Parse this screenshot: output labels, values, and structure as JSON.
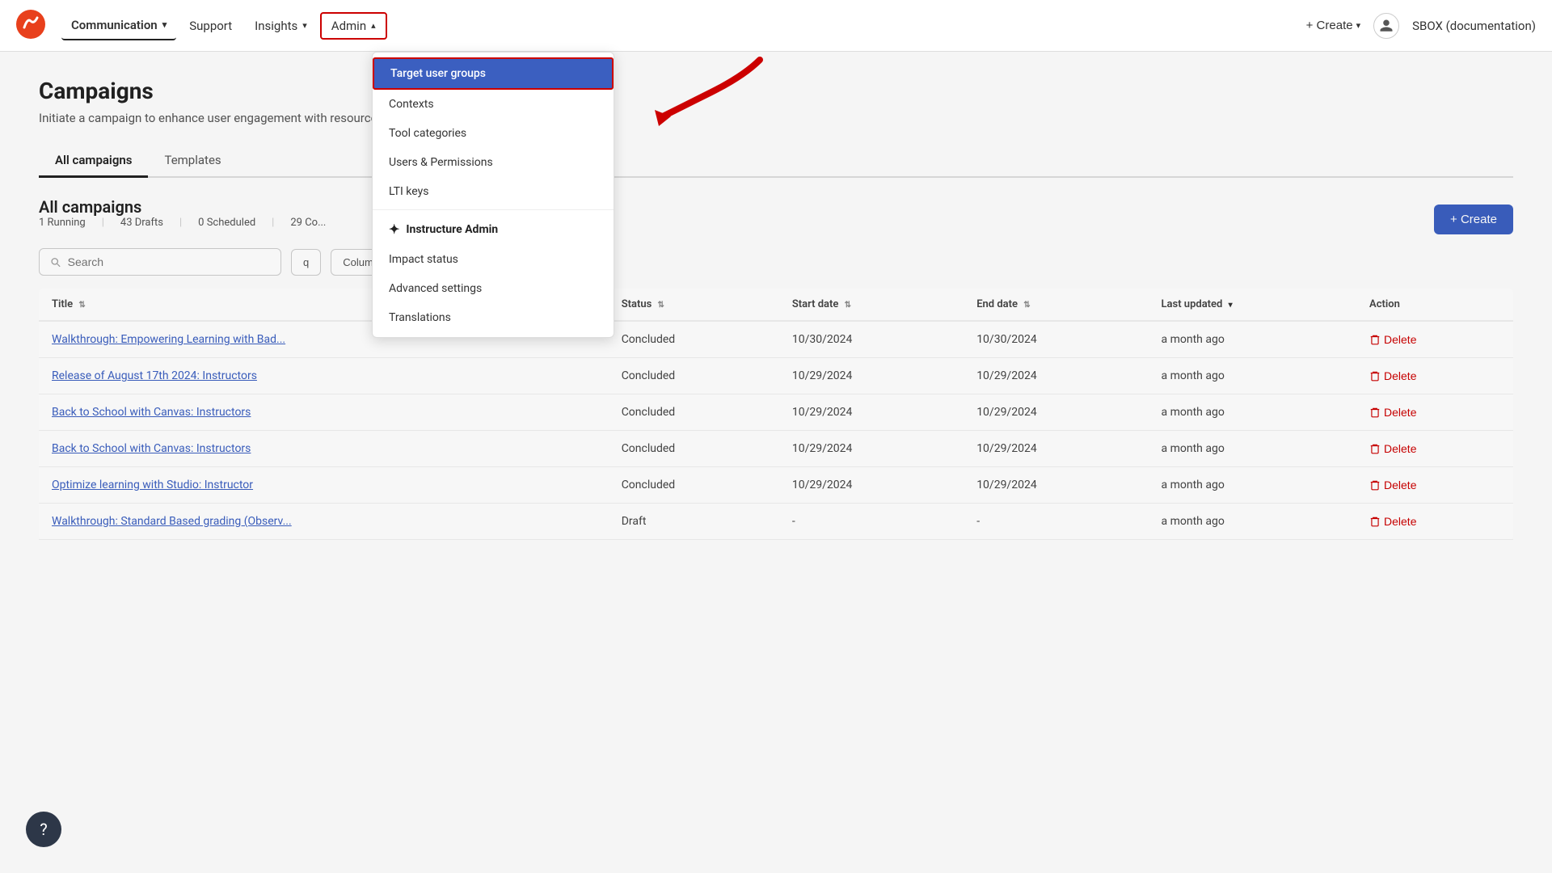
{
  "header": {
    "logo_alt": "Instructure logo",
    "nav": [
      {
        "id": "communication",
        "label": "Communication",
        "has_dropdown": true,
        "active": true
      },
      {
        "id": "support",
        "label": "Support",
        "has_dropdown": false
      },
      {
        "id": "insights",
        "label": "Insights",
        "has_dropdown": true
      },
      {
        "id": "admin",
        "label": "Admin",
        "has_dropdown": true,
        "open": true
      }
    ],
    "create_label": "+ Create",
    "org_name": "SBOX (documentation)"
  },
  "admin_dropdown": {
    "items": [
      {
        "id": "target-user-groups",
        "label": "Target user groups",
        "highlighted": true
      },
      {
        "id": "contexts",
        "label": "Contexts"
      },
      {
        "id": "tool-categories",
        "label": "Tool categories"
      },
      {
        "id": "users-permissions",
        "label": "Users & Permissions"
      },
      {
        "id": "lti-keys",
        "label": "LTI keys"
      },
      {
        "id": "instructure-admin",
        "label": "Instructure Admin",
        "section_header": true
      },
      {
        "id": "impact-status",
        "label": "Impact status"
      },
      {
        "id": "advanced-settings",
        "label": "Advanced settings"
      },
      {
        "id": "translations",
        "label": "Translations"
      }
    ]
  },
  "page": {
    "title": "Campaigns",
    "subtitle": "Initiate a campaign to enhance user engagement with resources and tools",
    "tabs": [
      {
        "id": "all-campaigns",
        "label": "All campaigns",
        "active": true
      },
      {
        "id": "templates",
        "label": "Templates"
      }
    ]
  },
  "campaigns_section": {
    "title": "All campaigns",
    "stats": [
      {
        "label": "1 Running"
      },
      {
        "label": "43 Drafts"
      },
      {
        "label": "0 Scheduled"
      },
      {
        "label": "29 Co..."
      }
    ],
    "create_button": "+ Create",
    "search_placeholder": "Search",
    "filter_label": "q",
    "columns_label": "Columns visibility"
  },
  "table": {
    "columns": [
      {
        "id": "title",
        "label": "Title",
        "sortable": true
      },
      {
        "id": "status",
        "label": "Status",
        "sortable": true
      },
      {
        "id": "start_date",
        "label": "Start date",
        "sortable": true
      },
      {
        "id": "end_date",
        "label": "End date",
        "sortable": true
      },
      {
        "id": "last_updated",
        "label": "Last updated",
        "sortable": true,
        "active_sort": true
      },
      {
        "id": "action",
        "label": "Action",
        "sortable": false
      }
    ],
    "rows": [
      {
        "title": "Walkthrough: Empowering Learning with Bad...",
        "status": "Concluded",
        "start_date": "10/30/2024",
        "end_date": "10/30/2024",
        "last_updated": "a month ago",
        "action": "Delete"
      },
      {
        "title": "Release of August 17th 2024: Instructors",
        "status": "Concluded",
        "start_date": "10/29/2024",
        "end_date": "10/29/2024",
        "last_updated": "a month ago",
        "action": "Delete"
      },
      {
        "title": "Back to School with Canvas: Instructors",
        "status": "Concluded",
        "start_date": "10/29/2024",
        "end_date": "10/29/2024",
        "last_updated": "a month ago",
        "action": "Delete"
      },
      {
        "title": "Back to School with Canvas: Instructors",
        "status": "Concluded",
        "start_date": "10/29/2024",
        "end_date": "10/29/2024",
        "last_updated": "a month ago",
        "action": "Delete"
      },
      {
        "title": "Optimize learning with Studio: Instructor",
        "status": "Concluded",
        "start_date": "10/29/2024",
        "end_date": "10/29/2024",
        "last_updated": "a month ago",
        "action": "Delete"
      },
      {
        "title": "Walkthrough: Standard Based grading (Observ...",
        "status": "Draft",
        "start_date": "-",
        "end_date": "-",
        "last_updated": "a month ago",
        "action": "Delete"
      }
    ]
  },
  "help": {
    "icon": "?"
  },
  "colors": {
    "accent_blue": "#3b5fc0",
    "delete_red": "#cc0000",
    "highlight_blue": "#3b5fc0",
    "border_red": "#cc0000"
  }
}
